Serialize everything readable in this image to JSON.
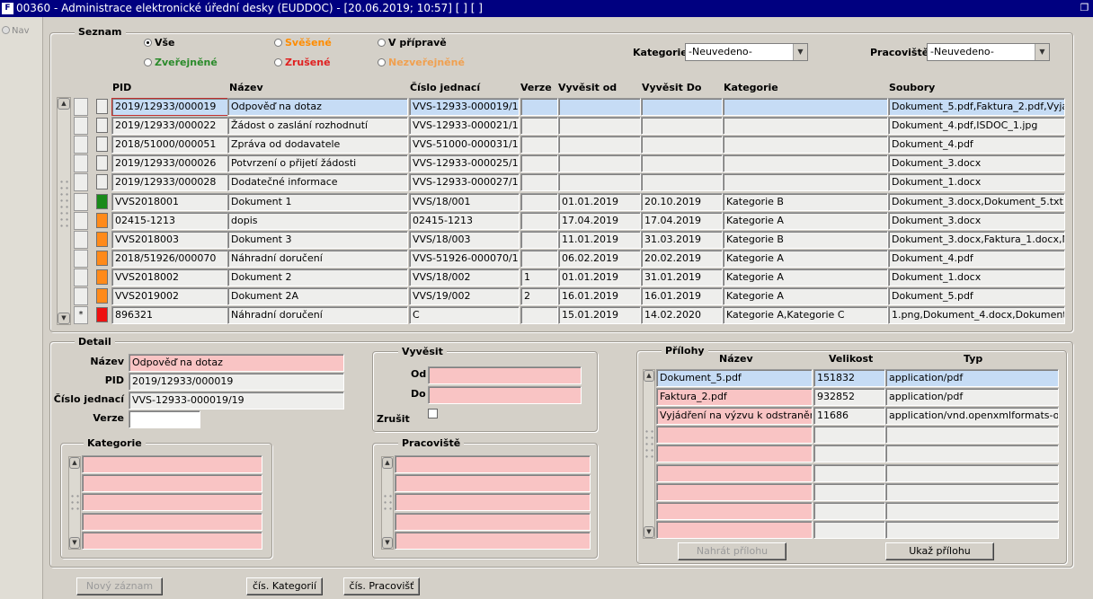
{
  "window": {
    "title": "00360 - Administrace elektronické úřední desky (EUDDOC) - [20.06.2019; 10:57]  [ ]  [ ]"
  },
  "nav": {
    "label": "Nav"
  },
  "seznam": {
    "title": "Seznam",
    "filters": [
      "Vše",
      "Svěšené",
      "V přípravě",
      "Zveřejněné",
      "Zrušené",
      "Nezveřejněné"
    ],
    "selected_filter": "Vše",
    "filter_colors": {
      "vse": "#000000",
      "svesene": "#ff8c00",
      "vpriprave": "#000000",
      "zverejnene": "#2a8a2a",
      "zrusene": "#e02020",
      "nezverejnene": "#f0a050"
    },
    "kategorie_label": "Kategorie",
    "kategorie_value": "-Neuvedeno-",
    "pracoviste_label": "Pracoviště",
    "pracoviste_value": "-Neuvedeno-",
    "columns": [
      "PID",
      "Název",
      "Číslo jednací",
      "Verze",
      "Vyvěsit od",
      "Vyvěsit Do",
      "Kategorie",
      "Soubory"
    ],
    "rows": [
      {
        "status": "",
        "pid": "2019/12933/000019",
        "nazev": "Odpověď na dotaz",
        "cislo": "VVS-12933-000019/19",
        "verze": "",
        "od": "",
        "do": "",
        "kategorie": "",
        "soubory": "Dokument_5.pdf,Faktura_2.pdf,Vyjádřen"
      },
      {
        "status": "",
        "pid": "2019/12933/000022",
        "nazev": "Žádost o zaslání rozhodnutí",
        "cislo": "VVS-12933-000021/19",
        "verze": "",
        "od": "",
        "do": "",
        "kategorie": "",
        "soubory": "Dokument_4.pdf,ISDOC_1.jpg"
      },
      {
        "status": "",
        "pid": "2018/51000/000051",
        "nazev": "Zpráva od dodavatele",
        "cislo": "VVS-51000-000031/18",
        "verze": "",
        "od": "",
        "do": "",
        "kategorie": "",
        "soubory": "Dokument_4.pdf"
      },
      {
        "status": "",
        "pid": "2019/12933/000026",
        "nazev": "Potvrzení o přijetí žádosti",
        "cislo": "VVS-12933-000025/19",
        "verze": "",
        "od": "",
        "do": "",
        "kategorie": "",
        "soubory": "Dokument_3.docx"
      },
      {
        "status": "",
        "pid": "2019/12933/000028",
        "nazev": "Dodatečné informace",
        "cislo": "VVS-12933-000027/19",
        "verze": "",
        "od": "",
        "do": "",
        "kategorie": "",
        "soubory": "Dokument_1.docx"
      },
      {
        "status": "#1a8a1a",
        "pid": "VVS2018001",
        "nazev": "Dokument 1",
        "cislo": "VVS/18/001",
        "verze": "",
        "od": "01.01.2019",
        "do": "20.10.2019",
        "kategorie": "Kategorie B",
        "soubory": "Dokument_3.docx,Dokument_5.txt"
      },
      {
        "status": "#ff8a1a",
        "pid": "02415-1213",
        "nazev": "dopis",
        "cislo": "02415-1213",
        "verze": "",
        "od": "17.04.2019",
        "do": "17.04.2019",
        "kategorie": "Kategorie A",
        "soubory": "Dokument_3.docx"
      },
      {
        "status": "#ff8a1a",
        "pid": "VVS2018003",
        "nazev": "Dokument 3",
        "cislo": "VVS/18/003",
        "verze": "",
        "od": "11.01.2019",
        "do": "31.03.2019",
        "kategorie": "Kategorie B",
        "soubory": "Dokument_3.docx,Faktura_1.docx,Motor"
      },
      {
        "status": "#ff8a1a",
        "pid": "2018/51926/000070",
        "nazev": "Náhradní doručení",
        "cislo": "VVS-51926-000070/18",
        "verze": "",
        "od": "06.02.2019",
        "do": "20.02.2019",
        "kategorie": "Kategorie A",
        "soubory": "Dokument_4.pdf"
      },
      {
        "status": "#ff8a1a",
        "pid": "VVS2018002",
        "nazev": "Dokument 2",
        "cislo": "VVS/18/002",
        "verze": "1",
        "od": "01.01.2019",
        "do": "31.01.2019",
        "kategorie": "Kategorie A",
        "soubory": "Dokument_1.docx"
      },
      {
        "status": "#ff8a1a",
        "pid": "VVS2019002",
        "nazev": "Dokument 2A",
        "cislo": "VVS/19/002",
        "verze": "2",
        "od": "16.01.2019",
        "do": "16.01.2019",
        "kategorie": "Kategorie A",
        "soubory": "Dokument_5.pdf"
      },
      {
        "status": "#ee1111",
        "pid": "896321",
        "nazev": "Náhradní doručení",
        "cislo": "C",
        "verze": "",
        "od": "15.01.2019",
        "do": "14.02.2020",
        "kategorie": "Kategorie A,Kategorie C",
        "soubory": "1.png,Dokument_4.docx,Dokument_4.do"
      }
    ],
    "last_row_marker": "*"
  },
  "detail": {
    "title": "Detail",
    "nazev_label": "Název",
    "nazev_value": "Odpověď na dotaz",
    "pid_label": "PID",
    "pid_value": "2019/12933/000019",
    "cislo_label": "Číslo jednací",
    "cislo_value": "VVS-12933-000019/19",
    "verze_label": "Verze",
    "verze_value": "",
    "vyvesit": {
      "title": "Vyvěsit",
      "od_label": "Od",
      "do_label": "Do",
      "zrusit_label": "Zrušit"
    },
    "kategorie_title": "Kategorie",
    "pracoviste_title": "Pracoviště",
    "prilohy": {
      "title": "Přílohy",
      "columns": [
        "Název",
        "Velikost",
        "Typ"
      ],
      "rows": [
        {
          "nazev": "Dokument_5.pdf",
          "velikost": "151832",
          "typ": "application/pdf"
        },
        {
          "nazev": "Faktura_2.pdf",
          "velikost": "932852",
          "typ": "application/pdf"
        },
        {
          "nazev": "Vyjádření na výzvu k odstranění ne",
          "velikost": "11686",
          "typ": "application/vnd.openxmlformats-officed"
        }
      ],
      "upload_button": "Nahrát přílohu",
      "show_button": "Ukaž přílohu"
    }
  },
  "buttons": {
    "new_record": "Nový záznam",
    "cis_kategorii": "čís. Kategorií",
    "cis_pracovist": "čís. Pracovišť"
  }
}
